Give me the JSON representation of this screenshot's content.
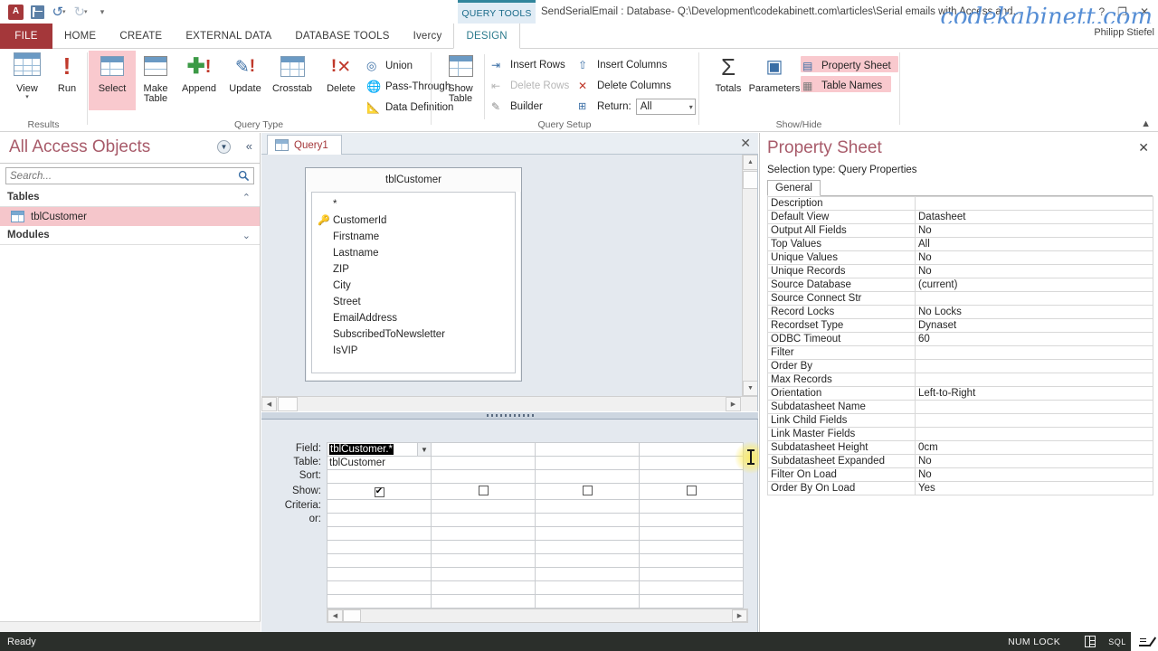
{
  "titlebar": {
    "app_icon": "access-logo-icon",
    "qat": [
      {
        "name": "save-button",
        "icon": "save-icon"
      },
      {
        "name": "undo-button",
        "icon": "undo-icon"
      },
      {
        "name": "redo-button",
        "icon": "redo-icon"
      },
      {
        "name": "customize-qat-button",
        "icon": "chevron-down-icon"
      }
    ],
    "contextual_tab_group": "QUERY TOOLS",
    "title": "SendSerialEmail : Database- Q:\\Development\\codekabinett.com\\articles\\Serial emails with Access and...",
    "watermark": "codekabinett.com",
    "user": "Philipp Stiefel",
    "help_label": "?",
    "restore_label": "❐",
    "close_label": "✕"
  },
  "ribbon": {
    "file_tab": "FILE",
    "tabs": [
      {
        "label": "HOME",
        "active": false
      },
      {
        "label": "CREATE",
        "active": false
      },
      {
        "label": "EXTERNAL DATA",
        "active": false
      },
      {
        "label": "DATABASE TOOLS",
        "active": false
      },
      {
        "label": "Ivercy",
        "active": false
      },
      {
        "label": "DESIGN",
        "active": true
      }
    ],
    "collapse_label": "▲",
    "groups": {
      "results": {
        "label": "Results",
        "view_label": "View",
        "view_caret": "▾",
        "run_label": "Run"
      },
      "query_type": {
        "label": "Query Type",
        "select_label": "Select",
        "make_table_label": "Make",
        "make_table_label2": "Table",
        "append_label": "Append",
        "update_label": "Update",
        "crosstab_label": "Crosstab",
        "delete_label": "Delete",
        "union_label": "Union",
        "passthrough_label": "Pass-Through",
        "datadefinition_label": "Data Definition"
      },
      "query_setup": {
        "label": "Query Setup",
        "show_table_label": "Show",
        "show_table_label2": "Table",
        "insert_rows_label": "Insert Rows",
        "delete_rows_label": "Delete Rows",
        "builder_label": "Builder",
        "insert_columns_label": "Insert Columns",
        "delete_columns_label": "Delete Columns",
        "return_label": "Return:",
        "return_value": "All",
        "return_caret": "▾"
      },
      "show_hide": {
        "label": "Show/Hide",
        "totals_label": "Totals",
        "totals_glyph": "Σ",
        "parameters_label": "Parameters",
        "property_sheet_label": "Property Sheet",
        "table_names_label": "Table Names"
      }
    }
  },
  "navpane": {
    "title": "All Access Objects",
    "dropdown_glyph": "▼",
    "collapse_glyph": "«",
    "search": {
      "placeholder": "Search...",
      "value": "",
      "icon": "search-icon"
    },
    "groups": [
      {
        "label": "Tables",
        "chevron": "⌃",
        "expanded": true,
        "items": [
          {
            "label": "tblCustomer",
            "icon": "table-icon",
            "selected": true
          }
        ]
      },
      {
        "label": "Modules",
        "chevron": "⌄",
        "expanded": false,
        "items": []
      }
    ]
  },
  "document": {
    "tab": {
      "label": "Query1",
      "icon": "query-icon"
    },
    "close_label": "✕"
  },
  "diagram": {
    "table": {
      "name": "tblCustomer",
      "fields": [
        {
          "name": "*",
          "key": false
        },
        {
          "name": "CustomerId",
          "key": true
        },
        {
          "name": "Firstname",
          "key": false
        },
        {
          "name": "Lastname",
          "key": false
        },
        {
          "name": "ZIP",
          "key": false
        },
        {
          "name": "City",
          "key": false
        },
        {
          "name": "Street",
          "key": false
        },
        {
          "name": "EmailAddress",
          "key": false
        },
        {
          "name": "SubscribedToNewsletter",
          "key": false
        },
        {
          "name": "IsVIP",
          "key": false
        }
      ]
    },
    "scroll": {
      "up": "▲",
      "down": "▼",
      "left": "◀",
      "right": "▶"
    }
  },
  "grid": {
    "row_labels": [
      "Field:",
      "Table:",
      "Sort:",
      "Show:",
      "Criteria:",
      "or:"
    ],
    "columns": [
      {
        "field": "tblCustomer.*",
        "field_selected": true,
        "table": "tblCustomer",
        "sort": "",
        "show": true,
        "criteria": "",
        "or": ""
      },
      {
        "field": "",
        "field_selected": false,
        "table": "",
        "sort": "",
        "show": false,
        "criteria": "",
        "or": ""
      },
      {
        "field": "",
        "field_selected": false,
        "table": "",
        "sort": "",
        "show": false,
        "criteria": "",
        "or": ""
      },
      {
        "field": "",
        "field_selected": false,
        "table": "",
        "sort": "",
        "show": false,
        "criteria": "",
        "or": ""
      }
    ],
    "check_glyph": "✔",
    "dropdown_glyph": "▼"
  },
  "property_sheet": {
    "title": "Property Sheet",
    "close_label": "✕",
    "selection_type": "Selection type:  Query Properties",
    "tabs": [
      {
        "label": "General",
        "active": true
      }
    ],
    "rows": [
      {
        "key": "Description",
        "value": ""
      },
      {
        "key": "Default View",
        "value": "Datasheet"
      },
      {
        "key": "Output All Fields",
        "value": "No"
      },
      {
        "key": "Top Values",
        "value": "All"
      },
      {
        "key": "Unique Values",
        "value": "No"
      },
      {
        "key": "Unique Records",
        "value": "No"
      },
      {
        "key": "Source Database",
        "value": "(current)"
      },
      {
        "key": "Source Connect Str",
        "value": ""
      },
      {
        "key": "Record Locks",
        "value": "No Locks"
      },
      {
        "key": "Recordset Type",
        "value": "Dynaset"
      },
      {
        "key": "ODBC Timeout",
        "value": "60"
      },
      {
        "key": "Filter",
        "value": ""
      },
      {
        "key": "Order By",
        "value": ""
      },
      {
        "key": "Max Records",
        "value": ""
      },
      {
        "key": "Orientation",
        "value": "Left-to-Right"
      },
      {
        "key": "Subdatasheet Name",
        "value": ""
      },
      {
        "key": "Link Child Fields",
        "value": ""
      },
      {
        "key": "Link Master Fields",
        "value": ""
      },
      {
        "key": "Subdatasheet Height",
        "value": "0cm"
      },
      {
        "key": "Subdatasheet Expanded",
        "value": "No"
      },
      {
        "key": "Filter On Load",
        "value": "No"
      },
      {
        "key": "Order By On Load",
        "value": "Yes"
      }
    ]
  },
  "statusbar": {
    "status": "Ready",
    "num_lock": "NUM LOCK",
    "views": [
      {
        "name": "datasheet-view-button",
        "icon": "datasheet-icon",
        "active": false
      },
      {
        "name": "sql-view-button",
        "icon": "sql-icon",
        "label": "SQL",
        "active": false
      },
      {
        "name": "design-view-button",
        "icon": "design-view-icon",
        "active": true
      }
    ]
  },
  "colors": {
    "accent_red": "#a4373a",
    "selection_pink": "#f5c6cb",
    "contextual_teal": "#31859c",
    "statusbar_dark": "#2b2f2b"
  }
}
